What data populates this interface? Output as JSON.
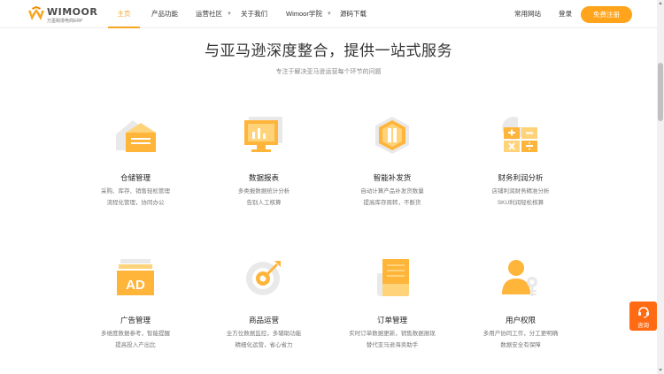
{
  "brand": {
    "name": "WIMOOR",
    "subtitle": "万墨跨境电商ERP",
    "accent": "#ffa41b",
    "icon": "wimoor-logo"
  },
  "nav": {
    "items": [
      {
        "label": "主页",
        "active": true
      },
      {
        "label": "产品功能"
      },
      {
        "label": "运营社区",
        "has_dropdown": true
      },
      {
        "label": "关于我们"
      },
      {
        "label": "Wimoor学院",
        "has_dropdown": true
      },
      {
        "label": "源码下载"
      }
    ],
    "common_sites": "常用网站",
    "login": "登录",
    "register": "免费注册"
  },
  "section": {
    "title": "与亚马逊深度整合，提供一站式服务",
    "subtitle": "专注于解决亚马逊运营每个环节的问题"
  },
  "features": [
    {
      "name": "仓储管理",
      "desc1": "采购、库存、销售轻松管理",
      "desc2": "流程化管理，协同办公",
      "icon": "warehouse-icon"
    },
    {
      "name": "数据报表",
      "desc1": "多类报数据统计分析",
      "desc2": "告别人工核算",
      "icon": "report-icon"
    },
    {
      "name": "智能补发货",
      "desc1": "自动计算产品补发货数量",
      "desc2": "提高库存周转，不断货",
      "icon": "restock-icon"
    },
    {
      "name": "财务利润分析",
      "desc1": "店铺利润财务精准分析",
      "desc2": "SKU利润轻松核算",
      "icon": "finance-icon"
    },
    {
      "name": "广告管理",
      "desc1": "多维度数据参考，智能提醒",
      "desc2": "提高投入产出比",
      "icon": "ad-icon"
    },
    {
      "name": "商品运营",
      "desc1": "全方位数据监控，多辅助功能",
      "desc2": "精细化运营，省心省力",
      "icon": "target-icon"
    },
    {
      "name": "订单管理",
      "desc1": "实时订单数据更新，销售数据展现",
      "desc2": "替代亚马逊海卖助手",
      "icon": "order-icon"
    },
    {
      "name": "用户权限",
      "desc1": "多用户协同工作，分工更明确",
      "desc2": "数据安全有保障",
      "icon": "user-key-icon"
    }
  ],
  "consult": {
    "label": "咨询",
    "color": "#ff6a13",
    "icon": "headset-icon"
  }
}
